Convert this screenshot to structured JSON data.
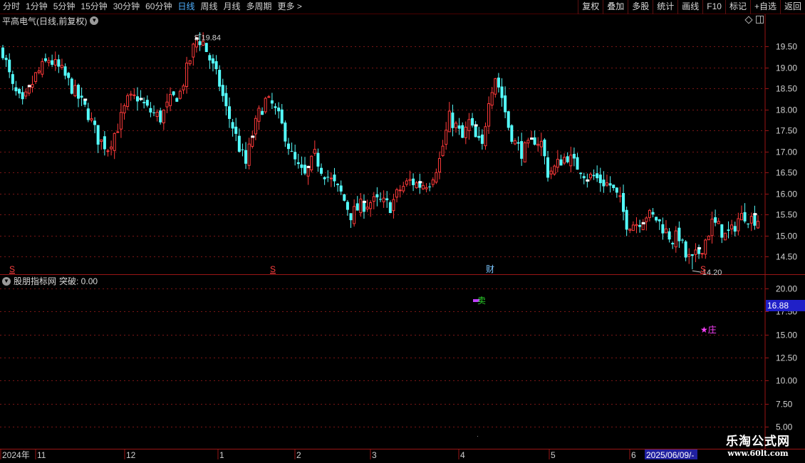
{
  "toolbar": {
    "periods": [
      {
        "label": "分时",
        "active": false
      },
      {
        "label": "1分钟",
        "active": false
      },
      {
        "label": "5分钟",
        "active": false
      },
      {
        "label": "15分钟",
        "active": false
      },
      {
        "label": "30分钟",
        "active": false
      },
      {
        "label": "60分钟",
        "active": false
      },
      {
        "label": "日线",
        "active": true
      },
      {
        "label": "周线",
        "active": false
      },
      {
        "label": "月线",
        "active": false
      },
      {
        "label": "多周期",
        "active": false
      },
      {
        "label": "更多 >",
        "active": false
      }
    ],
    "tools": [
      "复权",
      "叠加",
      "多股",
      "统计",
      "画线",
      "F10",
      "标记",
      "+自选",
      "返回"
    ]
  },
  "main_chart": {
    "title": "平高电气(日线,前复权)",
    "high_label": "19.84",
    "low_label": "14.20",
    "markers": [
      {
        "text": "S",
        "color": "#ff4040"
      },
      {
        "text": "S",
        "color": "#ff4040"
      },
      {
        "text": "财",
        "color": "#7cc6ff"
      },
      {
        "text": "S",
        "color": "#ff4040"
      }
    ]
  },
  "indicator": {
    "title": "股朋指标网",
    "value_label": "突破: 0.00",
    "sell_label": "卖",
    "zhuang_label": "★庄",
    "current_value": "16.88"
  },
  "time_axis": {
    "labels": [
      "2024年",
      "11",
      "12",
      "1",
      "2",
      "3",
      "4",
      "5",
      "6"
    ],
    "cursor_date": "2025/06/09/-"
  },
  "watermark": {
    "title": "乐淘公式网",
    "url": "www.60lt.com"
  },
  "chart_data": {
    "type": "candlestick",
    "title": "平高电气(日线,前复权)",
    "price_axis": {
      "ticks": [
        "19.50",
        "19.00",
        "18.50",
        "18.00",
        "17.50",
        "17.00",
        "16.50",
        "16.00",
        "15.50",
        "15.00",
        "14.50"
      ],
      "range": [
        14.1,
        19.98
      ]
    },
    "indicator_axis": {
      "ticks": [
        "20.00",
        "17.50",
        "15.00",
        "12.50",
        "10.00",
        "7.50",
        "5.00"
      ],
      "range": [
        2.9,
        21.4
      ]
    },
    "x_labels": [
      "2024年",
      "11",
      "12",
      "1",
      "2",
      "3",
      "4",
      "5",
      "6"
    ],
    "highest": 19.84,
    "lowest": 14.2,
    "anchors": [
      [
        0,
        19.4
      ],
      [
        3,
        18.5
      ],
      [
        6,
        18.1
      ],
      [
        10,
        18.8
      ],
      [
        14,
        19.2
      ],
      [
        18,
        18.9
      ],
      [
        22,
        18.4
      ],
      [
        26,
        17.9
      ],
      [
        29,
        17.3
      ],
      [
        32,
        17.1
      ],
      [
        35,
        17.6
      ],
      [
        38,
        18.2
      ],
      [
        41,
        18.3
      ],
      [
        44,
        18.0
      ],
      [
        48,
        17.8
      ],
      [
        51,
        18.2
      ],
      [
        54,
        18.4
      ],
      [
        57,
        19.2
      ],
      [
        59,
        19.7
      ],
      [
        61,
        19.6
      ],
      [
        63,
        19.2
      ],
      [
        66,
        18.6
      ],
      [
        68,
        18.0
      ],
      [
        70,
        17.6
      ],
      [
        72,
        17.1
      ],
      [
        74,
        16.7
      ],
      [
        76,
        17.4
      ],
      [
        78,
        17.9
      ],
      [
        80,
        18.2
      ],
      [
        82,
        18.1
      ],
      [
        84,
        17.8
      ],
      [
        86,
        17.4
      ],
      [
        88,
        16.9
      ],
      [
        90,
        16.6
      ],
      [
        92,
        16.4
      ],
      [
        95,
        16.9
      ],
      [
        97,
        16.6
      ],
      [
        100,
        16.3
      ],
      [
        103,
        16.0
      ],
      [
        106,
        15.5
      ],
      [
        109,
        15.7
      ],
      [
        112,
        15.8
      ],
      [
        115,
        15.8
      ],
      [
        118,
        15.7
      ],
      [
        121,
        16.1
      ],
      [
        124,
        16.3
      ],
      [
        127,
        16.2
      ],
      [
        130,
        16.3
      ],
      [
        133,
        16.8
      ],
      [
        136,
        17.8
      ],
      [
        138,
        17.6
      ],
      [
        140,
        17.3
      ],
      [
        142,
        17.7
      ],
      [
        144,
        17.3
      ],
      [
        146,
        17.1
      ],
      [
        148,
        18.3
      ],
      [
        150,
        18.8
      ],
      [
        152,
        18.3
      ],
      [
        154,
        17.6
      ],
      [
        156,
        17.2
      ],
      [
        158,
        17.0
      ],
      [
        160,
        17.1
      ],
      [
        162,
        17.3
      ],
      [
        164,
        17.2
      ],
      [
        166,
        16.5
      ],
      [
        168,
        16.6
      ],
      [
        170,
        16.8
      ],
      [
        172,
        16.9
      ],
      [
        174,
        16.7
      ],
      [
        176,
        16.6
      ],
      [
        178,
        16.4
      ],
      [
        180,
        16.4
      ],
      [
        182,
        16.3
      ],
      [
        185,
        16.2
      ],
      [
        188,
        15.8
      ],
      [
        190,
        15.3
      ],
      [
        193,
        15.3
      ],
      [
        196,
        15.5
      ],
      [
        199,
        15.4
      ],
      [
        202,
        15.1
      ],
      [
        204,
        14.9
      ],
      [
        206,
        15.0
      ],
      [
        208,
        14.5
      ],
      [
        210,
        14.4
      ],
      [
        212,
        14.6
      ],
      [
        214,
        14.9
      ],
      [
        216,
        15.3
      ],
      [
        218,
        15.2
      ],
      [
        220,
        15.0
      ],
      [
        222,
        15.1
      ],
      [
        224,
        15.4
      ],
      [
        226,
        15.5
      ],
      [
        228,
        15.4
      ],
      [
        230,
        15.4
      ]
    ]
  }
}
